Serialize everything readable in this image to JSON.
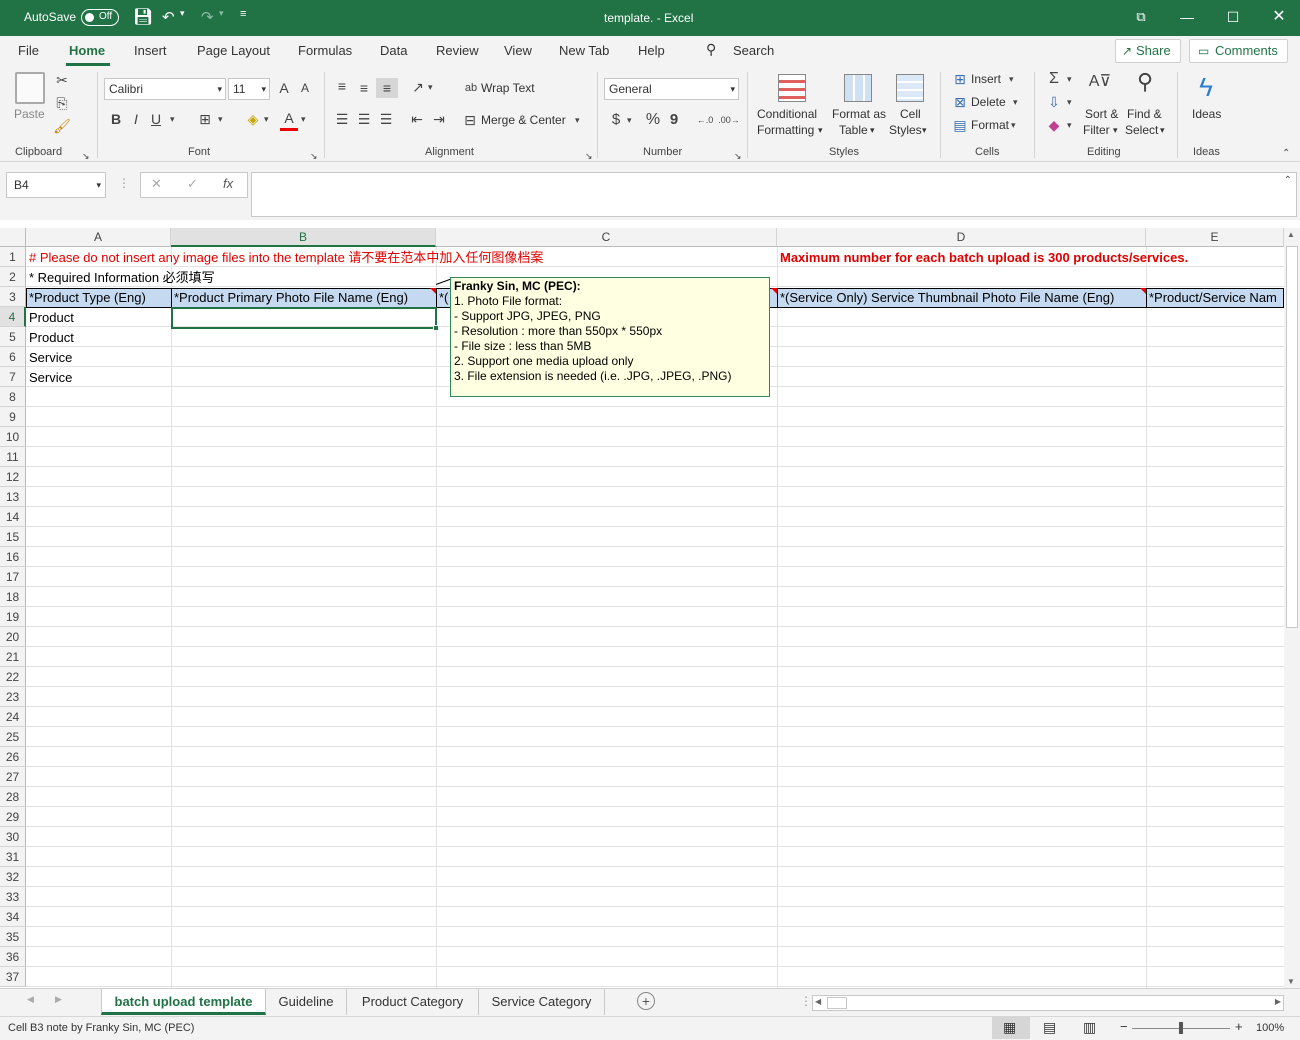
{
  "titlebar": {
    "autosave_label": "AutoSave",
    "autosave_state": "Off",
    "title": "template.  -  Excel"
  },
  "menu": {
    "items": [
      "File",
      "Home",
      "Insert",
      "Page Layout",
      "Formulas",
      "Data",
      "Review",
      "View",
      "New Tab",
      "Help"
    ],
    "search": "Search",
    "share": "Share",
    "comments": "Comments"
  },
  "ribbon": {
    "clipboard": {
      "paste": "Paste",
      "label": "Clipboard"
    },
    "font": {
      "name": "Calibri",
      "size": "11",
      "bold": "B",
      "italic": "I",
      "underline": "U",
      "grow": "A",
      "shrink": "A",
      "color": "A",
      "label": "Font"
    },
    "alignment": {
      "wrap": "Wrap Text",
      "merge": "Merge & Center",
      "label": "Alignment"
    },
    "number": {
      "format": "General",
      "currency": "$",
      "percent": "%",
      "comma": "9",
      "label": "Number"
    },
    "styles": {
      "conditional1": "Conditional",
      "conditional2": "Formatting",
      "table1": "Format as",
      "table2": "Table",
      "cell1": "Cell",
      "cell2": "Styles",
      "label": "Styles"
    },
    "cells": {
      "insert": "Insert",
      "delete": "Delete",
      "format": "Format",
      "label": "Cells"
    },
    "editing": {
      "sum": "Σ",
      "sort1": "Sort &",
      "sort2": "Filter",
      "find1": "Find &",
      "find2": "Select",
      "label": "Editing"
    },
    "ideas": {
      "button": "Ideas",
      "label": "Ideas"
    }
  },
  "formula": {
    "namebox": "B4",
    "cancel": "✕",
    "enter": "✓",
    "fx": "fx",
    "value": ""
  },
  "grid": {
    "columns": [
      "A",
      "B",
      "C",
      "D",
      "E"
    ],
    "rows": [
      "1",
      "2",
      "3",
      "4",
      "5",
      "6",
      "7",
      "8",
      "9",
      "10",
      "11",
      "12",
      "13",
      "14",
      "15",
      "16",
      "17",
      "18",
      "19",
      "20",
      "21",
      "22",
      "23",
      "24",
      "25",
      "26",
      "27",
      "28",
      "29",
      "30",
      "31",
      "32",
      "33",
      "34",
      "35",
      "36",
      "37"
    ],
    "r1a": "# Please do not insert any image files into the template 请不要在范本中加入任何图像档案",
    "r1d": "Maximum number for each batch upload is 300 products/services.",
    "r2a": "* Required Information 必须填写",
    "headers": {
      "a": "*Product Type (Eng)",
      "b": "*Product Primary Photo File Name (Eng)",
      "c": "*(",
      "d": "*(Service Only) Service Thumbnail Photo File Name (Eng)",
      "e": "*Product/Service Nam"
    },
    "a4": "Product",
    "a5": "Product",
    "a6": "Service",
    "a7": "Service"
  },
  "comment": {
    "author": "Franky Sin, MC (PEC):",
    "lines": [
      "1. Photo File format:",
      "- Support JPG, JPEG, PNG",
      "- Resolution : more than 550px * 550px",
      "- File size : less than 5MB",
      "2. Support one media upload only",
      "3. File extension is needed (i.e. .JPG, .JPEG, .PNG)"
    ]
  },
  "sheets": {
    "tabs": [
      "batch upload template",
      "Guideline",
      "Product Category",
      "Service Category"
    ]
  },
  "status": {
    "text": "Cell B3 note by Franky Sin, MC (PEC)",
    "zoom_minus": "−",
    "zoom_plus": "+",
    "zoom": "100%"
  },
  "colors": {
    "accent": "#217346",
    "header_fill": "#c5d9f1",
    "note_fill": "#ffffe1",
    "warning": "#e00000"
  }
}
